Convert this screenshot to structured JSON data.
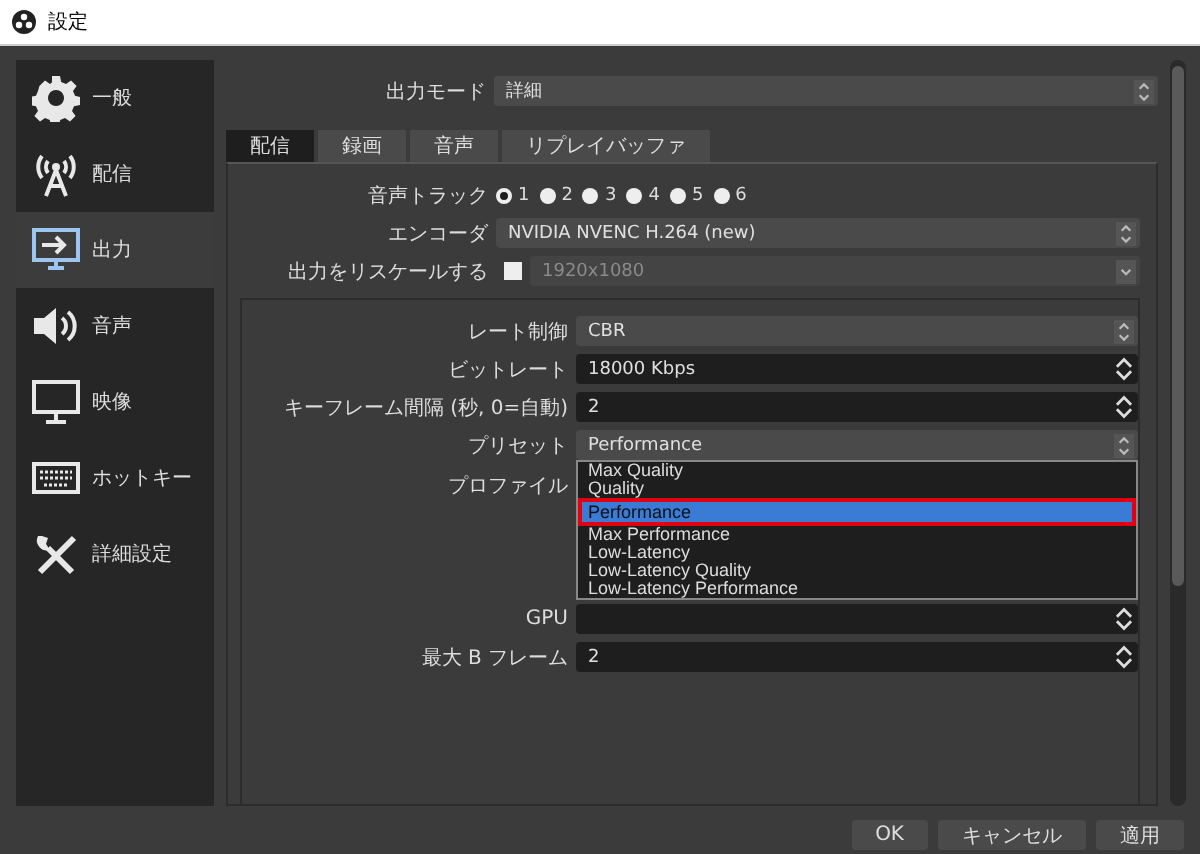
{
  "window": {
    "title": "設定"
  },
  "sidebar": {
    "items": [
      {
        "label": "一般",
        "kind": "gear",
        "selected": false
      },
      {
        "label": "配信",
        "kind": "antenna",
        "selected": false
      },
      {
        "label": "出力",
        "kind": "monitor-arrow",
        "selected": true
      },
      {
        "label": "音声",
        "kind": "speaker",
        "selected": false
      },
      {
        "label": "映像",
        "kind": "monitor",
        "selected": false
      },
      {
        "label": "ホットキー",
        "kind": "keyboard",
        "selected": false
      },
      {
        "label": "詳細設定",
        "kind": "tools",
        "selected": false
      }
    ]
  },
  "output_mode": {
    "label": "出力モード",
    "kind": "combo",
    "value": "詳細"
  },
  "tabs": [
    {
      "label": "配信",
      "selected": true
    },
    {
      "label": "録画",
      "selected": false
    },
    {
      "label": "音声",
      "selected": false
    },
    {
      "label": "リプレイバッファ",
      "selected": false
    }
  ],
  "stream_tab": {
    "audio_track": {
      "label": "音声トラック",
      "options": [
        {
          "label": "1",
          "selected": true
        },
        {
          "label": "2",
          "selected": false
        },
        {
          "label": "3",
          "selected": false
        },
        {
          "label": "4",
          "selected": false
        },
        {
          "label": "5",
          "selected": false
        },
        {
          "label": "6",
          "selected": false
        }
      ]
    },
    "rows": [
      {
        "kind": "combo",
        "label": "エンコーダ",
        "value": "NVIDIA NVENC H.264 (new)"
      },
      {
        "kind": "dropdown",
        "label": "出力をリスケールする",
        "checked": false,
        "disabled": true,
        "value": "1920x1080"
      }
    ]
  },
  "encoder_settings": {
    "rows": [
      {
        "kind": "combo",
        "label": "レート制御",
        "value": "CBR"
      },
      {
        "kind": "spin",
        "label": "ビットレート",
        "value": "18000 Kbps"
      },
      {
        "kind": "spin",
        "label": "キーフレーム間隔 (秒, 0=自動)",
        "value": "2"
      },
      {
        "kind": "combo",
        "label": "プリセット",
        "value": "Performance",
        "options": [
          {
            "label": "Max Quality",
            "selected": false
          },
          {
            "label": "Quality",
            "selected": false
          },
          {
            "label": "Performance",
            "selected": true
          },
          {
            "label": "Max Performance",
            "selected": false
          },
          {
            "label": "Low-Latency",
            "selected": false
          },
          {
            "label": "Low-Latency Quality",
            "selected": false
          },
          {
            "label": "Low-Latency Performance",
            "selected": false
          }
        ]
      },
      {
        "kind": "covered",
        "label": "プロファイル"
      },
      {
        "kind": "spin",
        "label": "GPU"
      },
      {
        "kind": "spin",
        "label": "最大 B フレーム",
        "value": "2"
      }
    ]
  },
  "buttons": [
    "OK",
    "キャンセル",
    "適用"
  ]
}
